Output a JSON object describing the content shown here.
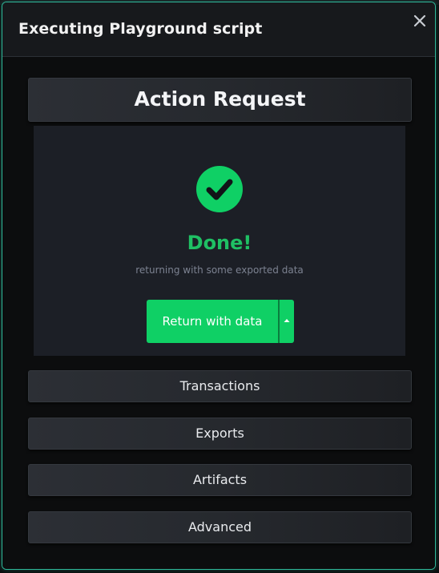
{
  "modal": {
    "title": "Executing Playground script"
  },
  "action_request": {
    "heading": "Action Request",
    "status_title": "Done!",
    "status_subtitle": "returning with some exported data",
    "primary_button_label": "Return with data"
  },
  "sections": {
    "transactions": "Transactions",
    "exports": "Exports",
    "artifacts": "Artifacts",
    "advanced": "Advanced"
  },
  "icons": {
    "close": "close-icon",
    "success": "check-circle-icon",
    "caret": "caret-up-icon"
  },
  "colors": {
    "accent_border": "#2fb89a",
    "success_green": "#0fd065",
    "done_text": "#1fc064",
    "background": "#0c0d0e",
    "result_panel": "#1c1f26"
  }
}
